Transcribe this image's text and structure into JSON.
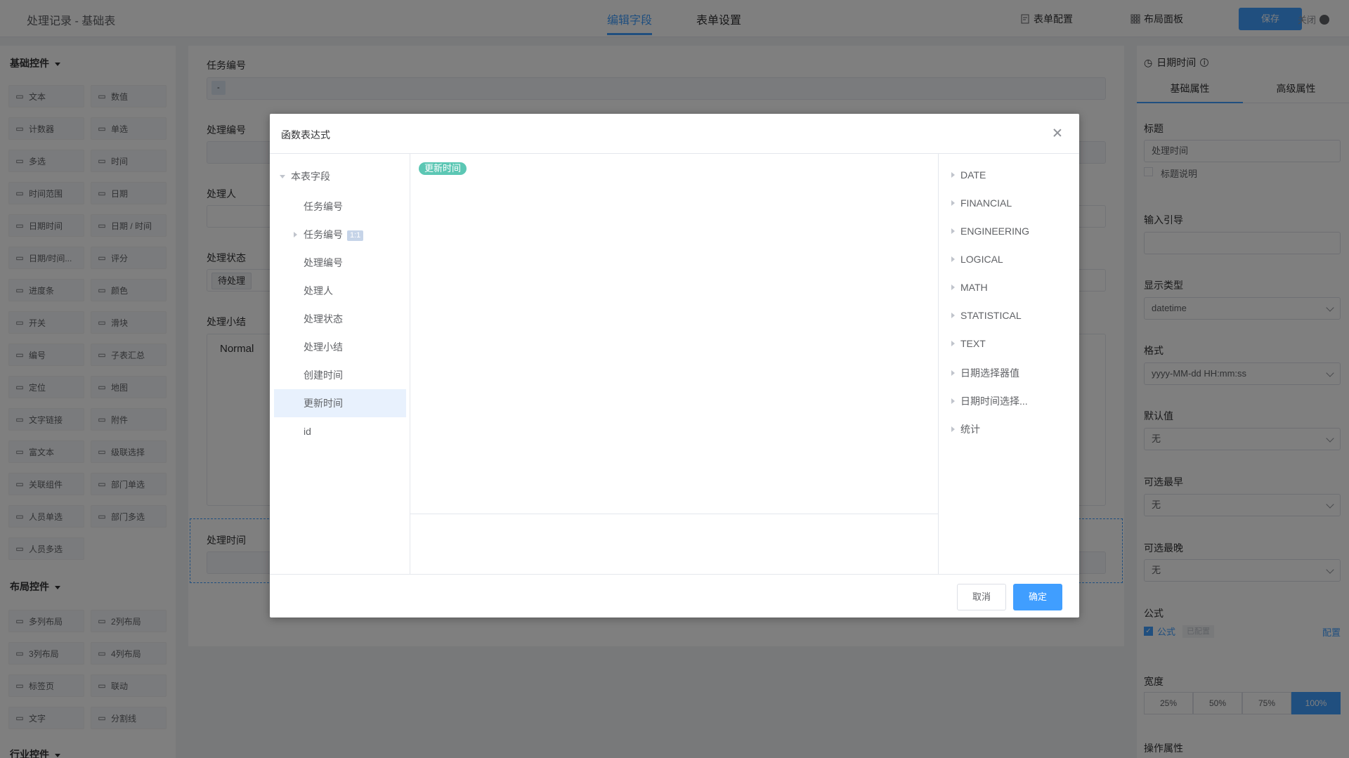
{
  "header": {
    "title": "处理记录 - 基础表",
    "tabs": [
      "编辑字段",
      "表单设置"
    ],
    "form_config": "表单配置",
    "layout_panel": "布局面板",
    "save": "保存",
    "close": "关闭"
  },
  "left": {
    "basic_title": "基础控件",
    "basic": [
      "文本",
      "数值",
      "计数器",
      "单选",
      "多选",
      "时间",
      "时间范围",
      "日期",
      "日期时间",
      "日期 / 时间",
      "日期/时间...",
      "评分",
      "进度条",
      "颜色",
      "开关",
      "滑块",
      "编号",
      "子表汇总",
      "定位",
      "地图",
      "文字链接",
      "附件",
      "富文本",
      "级联选择",
      "关联组件",
      "部门单选",
      "人员单选",
      "部门多选",
      "人员多选"
    ],
    "layout_title": "布局控件",
    "layout": [
      "多列布局",
      "2列布局",
      "3列布局",
      "4列布局",
      "标签页",
      "联动",
      "文字",
      "分割线"
    ],
    "industry_title": "行业控件"
  },
  "canvas": {
    "field1": "任务编号",
    "field1_value": "-",
    "field2": "处理编号",
    "field3": "处理人",
    "field4": "处理状态",
    "field4_value": "待处理",
    "field5": "处理小结",
    "editor_style": "Normal",
    "field6": "处理时间"
  },
  "right": {
    "head": "日期时间",
    "tabs": [
      "基础属性",
      "高级属性"
    ],
    "title_label": "标题",
    "title_value": "处理时间",
    "title_desc": "标题说明",
    "guide_label": "输入引导",
    "display_label": "显示类型",
    "display_value": "datetime",
    "format_label": "格式",
    "format_value": "yyyy-MM-dd HH:mm:ss",
    "default_label": "默认值",
    "default_value": "无",
    "earliest_label": "可选最早",
    "earliest_value": "无",
    "latest_label": "可选最晚",
    "latest_value": "无",
    "formula_label": "公式",
    "formula_check": "公式",
    "formula_tag": "已配置",
    "formula_config": "配置",
    "width_label": "宽度",
    "widths": [
      "25%",
      "50%",
      "75%",
      "100%"
    ],
    "op_label": "操作属性"
  },
  "dialog": {
    "title": "函数表达式",
    "tree_root": "本表字段",
    "tree_items": [
      "任务编号",
      "任务编号",
      "处理编号",
      "处理人",
      "处理状态",
      "处理小结",
      "创建时间",
      "更新时间",
      "id"
    ],
    "relation_tag": "1:1",
    "expression_tag": "更新时间",
    "functions": [
      "DATE",
      "FINANCIAL",
      "ENGINEERING",
      "LOGICAL",
      "MATH",
      "STATISTICAL",
      "TEXT",
      "日期选择器值",
      "日期时间选择...",
      "统计"
    ],
    "cancel": "取消",
    "ok": "确定"
  }
}
